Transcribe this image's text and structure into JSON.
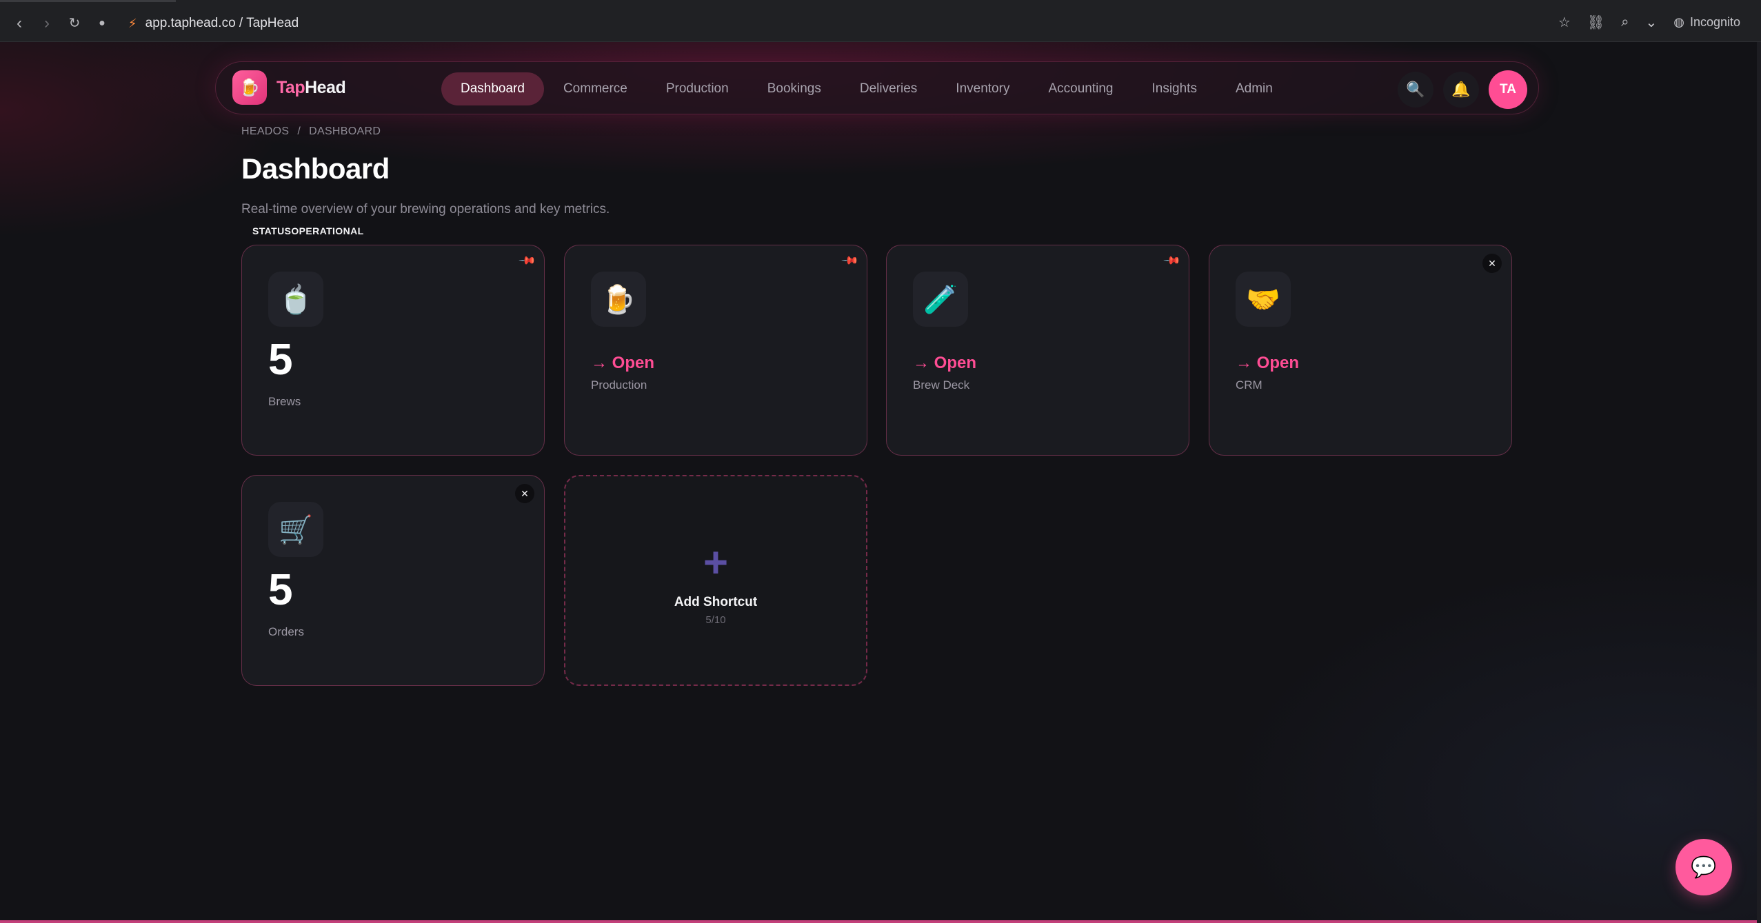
{
  "browser": {
    "url": "app.taphead.co / TapHead",
    "incognito_label": "Incognito"
  },
  "brand": {
    "name_part1": "Tap",
    "name_part2": "Head",
    "accent": "#ff4d94"
  },
  "nav": {
    "items": [
      {
        "label": "Dashboard",
        "active": true
      },
      {
        "label": "Commerce"
      },
      {
        "label": "Production"
      },
      {
        "label": "Bookings"
      },
      {
        "label": "Deliveries"
      },
      {
        "label": "Inventory"
      },
      {
        "label": "Accounting"
      },
      {
        "label": "Insights"
      },
      {
        "label": "Admin"
      }
    ],
    "avatar_initials": "TA"
  },
  "page": {
    "breadcrumb": [
      "HEADOS",
      "/",
      "DASHBOARD"
    ],
    "title": "Dashboard",
    "subtitle": "Real-time overview of your brewing operations and key metrics.",
    "status": "STATUSOPERATIONAL"
  },
  "cards": [
    {
      "icon": "brew-icon",
      "glyph": "🍵",
      "value": "5",
      "label": "Brews",
      "control": "pin"
    },
    {
      "icon": "beer-mug-icon",
      "glyph": "🍺",
      "action": "→ Open",
      "label": "Production",
      "control": "pin"
    },
    {
      "icon": "test-tube-icon",
      "glyph": "🧪",
      "action": "→ Open",
      "label": "Brew Deck",
      "control": "pin"
    },
    {
      "icon": "handshake-icon",
      "glyph": "🤝",
      "action": "→ Open",
      "label": "CRM",
      "control": "close"
    },
    {
      "icon": "shopping-cart-icon",
      "glyph": "🛒",
      "value": "5",
      "label": "Orders",
      "control": "close"
    }
  ],
  "add_shortcut": {
    "plus": "+",
    "label": "Add Shortcut",
    "count": "5/10"
  }
}
